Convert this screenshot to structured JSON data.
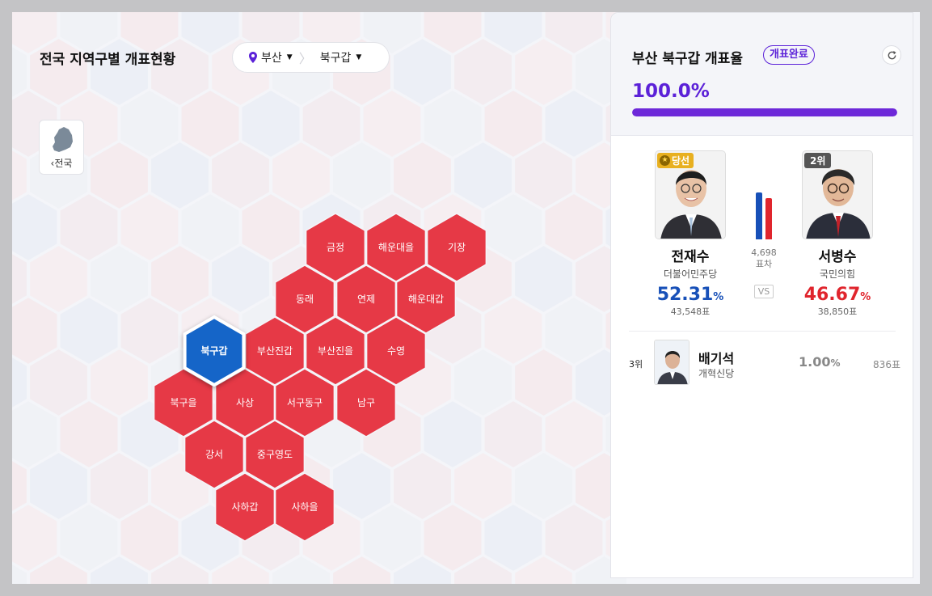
{
  "map": {
    "title": "전국 지역구별 개표현황",
    "region_select": "부산",
    "district_select": "북구갑",
    "back_label": "전국",
    "districts": [
      {
        "label": "금정",
        "party": "red"
      },
      {
        "label": "해운대을",
        "party": "red"
      },
      {
        "label": "기장",
        "party": "red"
      },
      {
        "label": "동래",
        "party": "red"
      },
      {
        "label": "연제",
        "party": "red"
      },
      {
        "label": "해운대갑",
        "party": "red"
      },
      {
        "label": "북구갑",
        "party": "blue",
        "selected": true
      },
      {
        "label": "부산진갑",
        "party": "red"
      },
      {
        "label": "부산진을",
        "party": "red"
      },
      {
        "label": "수영",
        "party": "red"
      },
      {
        "label": "북구을",
        "party": "red"
      },
      {
        "label": "사상",
        "party": "red"
      },
      {
        "label": "서구동구",
        "party": "red"
      },
      {
        "label": "남구",
        "party": "red"
      },
      {
        "label": "강서",
        "party": "red"
      },
      {
        "label": "중구영도",
        "party": "red"
      },
      {
        "label": "사하갑",
        "party": "red"
      },
      {
        "label": "사하을",
        "party": "red"
      }
    ]
  },
  "colors": {
    "red": "#e63946",
    "blue": "#1565c8",
    "accent": "#5b21d8"
  },
  "panel": {
    "title": "부산 북구갑 개표율",
    "status": "개표완료",
    "progress_pct": "100.0%",
    "progress_value": 100,
    "winner_label": "당선",
    "second_rank": "2위",
    "vs": "VS",
    "diff_votes": "4,698",
    "diff_label": "표차",
    "candidates": [
      {
        "name": "전재수",
        "party": "더불어민주당",
        "pct": "52.31",
        "pct_unit": "%",
        "votes": "43,548표"
      },
      {
        "name": "서병수",
        "party": "국민의힘",
        "pct": "46.67",
        "pct_unit": "%",
        "votes": "38,850표"
      }
    ],
    "third": {
      "rank": "3위",
      "name": "배기석",
      "party": "개혁신당",
      "pct": "1.00",
      "pct_unit": "%",
      "votes": "836표"
    }
  }
}
